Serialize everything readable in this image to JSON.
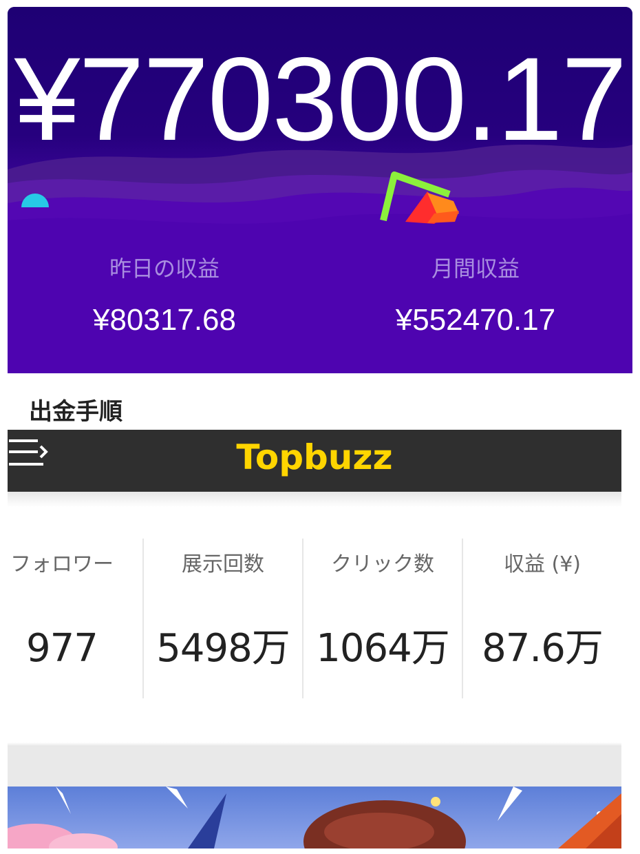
{
  "earnings": {
    "total_amount": "¥770300.17",
    "yesterday_label": "昨日の収益",
    "yesterday_value": "¥80317.68",
    "monthly_label": "月間収益",
    "monthly_value": "¥552470.17"
  },
  "withdrawal": {
    "heading": "出金手順"
  },
  "app_bar": {
    "title": "Topbuzz",
    "menu_icon": "menu-icon",
    "title_color": "#ffd500"
  },
  "stats": [
    {
      "label": "フォロワー",
      "value": "977"
    },
    {
      "label": "展示回数",
      "value": "5498万"
    },
    {
      "label": "クリック数",
      "value": "1064万"
    },
    {
      "label": "収益 (¥)",
      "value": "87.6万"
    }
  ],
  "colors": {
    "card_top": "#23007a",
    "card_bottom": "#4d04ad",
    "app_bar": "#2f2f2f",
    "accent_yellow": "#ffd500"
  }
}
